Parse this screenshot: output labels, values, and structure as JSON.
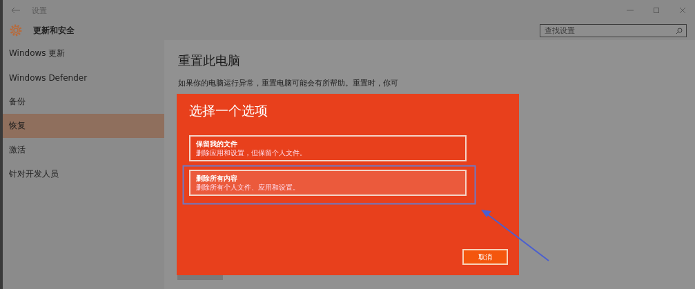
{
  "window": {
    "title": "设置"
  },
  "header": {
    "title": "更新和安全"
  },
  "search": {
    "placeholder": "查找设置"
  },
  "sidebar": {
    "items": [
      {
        "label": "Windows 更新",
        "selected": false
      },
      {
        "label": "Windows Defender",
        "selected": false
      },
      {
        "label": "备份",
        "selected": false
      },
      {
        "label": "恢复",
        "selected": true
      },
      {
        "label": "激活",
        "selected": false
      },
      {
        "label": "针对开发人员",
        "selected": false
      }
    ]
  },
  "content": {
    "heading": "重置此电脑",
    "paragraph": "如果你的电脑运行异常，重置电脑可能会有所帮助。重置时，你可"
  },
  "dialog": {
    "title": "选择一个选项",
    "options": [
      {
        "title": "保留我的文件",
        "description": "删除应用和设置，但保留个人文件。",
        "selected": false
      },
      {
        "title": "删除所有内容",
        "description": "删除所有个人文件、应用和设置。",
        "selected": true
      }
    ],
    "cancel": "取消"
  }
}
